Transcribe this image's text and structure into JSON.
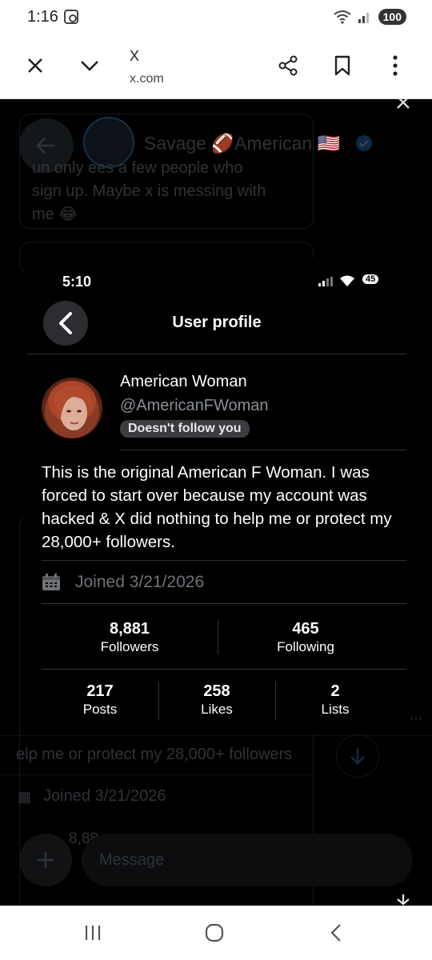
{
  "status_bar": {
    "time": "1:16",
    "battery": "100"
  },
  "browser": {
    "site_title": "X",
    "site_url": "x.com"
  },
  "background": {
    "author_name": "Savage 🏈American 🇺🇸",
    "reply_snippet": [
      "un only ees a few people who",
      "sign up. Maybe x is messing with",
      "me 😂"
    ],
    "bio_fragment": "elp me or protect my 28,000+ followers",
    "joined": "Joined 3/21/2026",
    "stat_fragment": "8,88",
    "message_placeholder": "Message"
  },
  "profile_shot": {
    "time": "5:10",
    "battery": "45",
    "title": "User profile",
    "display_name": "American Woman",
    "handle": "@AmericanFWoman",
    "follow_status": "Doesn't follow you",
    "bio": "This is the original American F Woman. I was forced to start over because my account was hacked & X did nothing to help me or protect my 28,000+ followers.",
    "joined": "Joined 3/21/2026",
    "stats_top": [
      {
        "value": "8,881",
        "label": "Followers"
      },
      {
        "value": "465",
        "label": "Following"
      }
    ],
    "stats_bottom": [
      {
        "value": "217",
        "label": "Posts"
      },
      {
        "value": "258",
        "label": "Likes"
      },
      {
        "value": "2",
        "label": "Lists"
      }
    ]
  }
}
